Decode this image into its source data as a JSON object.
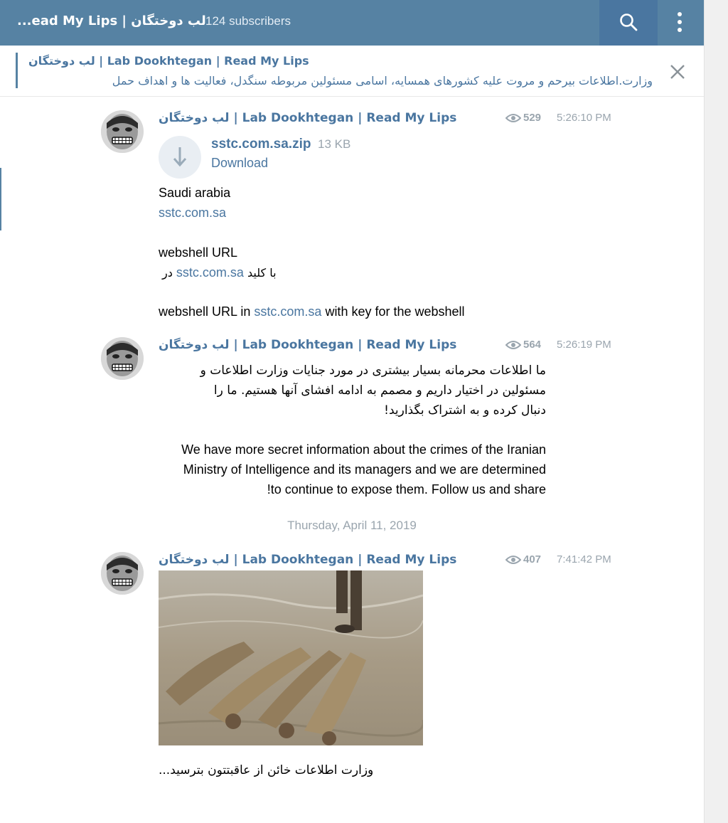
{
  "header": {
    "title": "...ead My Lips | لب دوختگان",
    "subscribers": "124 subscribers",
    "icons": [
      "search-icon",
      "more-vert-icon"
    ]
  },
  "pinned": {
    "title": "لب دوختگان | Lab Dookhtegan | Read My Lips",
    "text": "وزارت.اطلاعات بیرحم و مروت علیه کشورهای همسایه، اسامی مسئولین مربوطه سنگدل، فعالیت ها و اهداف حمل",
    "icon": "close-icon"
  },
  "messages": [
    {
      "author": "لب دوختگان | Lab Dookhtegan | Read My Lips",
      "views": "529",
      "time": "5:26:10 PM",
      "file": {
        "name": "sstc.com.sa.zip",
        "size": "13 KB",
        "action": "Download"
      },
      "lines": {
        "l1": "Saudi arabia",
        "l2_link": "sstc.com.sa",
        "l3": "webshell URL",
        "l4_text": " با کلید",
        "l4_link": "sstc.com.sa",
        "l4_suffix": " در",
        "l5_pre": "webshell URL in ",
        "l5_link": "sstc.com.sa",
        "l5_post": " with key for the webshell"
      }
    },
    {
      "author": "لب دوختگان | Lab Dookhtegan | Read My Lips",
      "views": "564",
      "time": "5:26:19 PM",
      "fa_lines": [
        "ما اطلاعات محرمانه بسیار بیشتری در مورد جنایات وزارت اطلاعات و",
        "مسئولین در اختیار داریم و مصمم به ادامه افشای آنها هستیم. ما را",
        "دنبال کرده و به اشتراک بگذارید!"
      ],
      "en_lines": [
        "We have more secret information about the crimes of the Iranian",
        "Ministry of Intelligence and its managers and we are determined",
        "!to continue to expose them.  Follow us and share"
      ]
    },
    {
      "author": "لب دوختگان | Lab Dookhtegan | Read My Lips",
      "views": "407",
      "time": "7:41:42 PM",
      "caption": "...وزارت اطلاعات خائن از عاقبتتون بترسید"
    }
  ],
  "date_separator": "Thursday, April 11, 2019",
  "colors": {
    "header": "#5682a3",
    "accent": "#4a76a0",
    "muted": "#9aa5ae"
  }
}
